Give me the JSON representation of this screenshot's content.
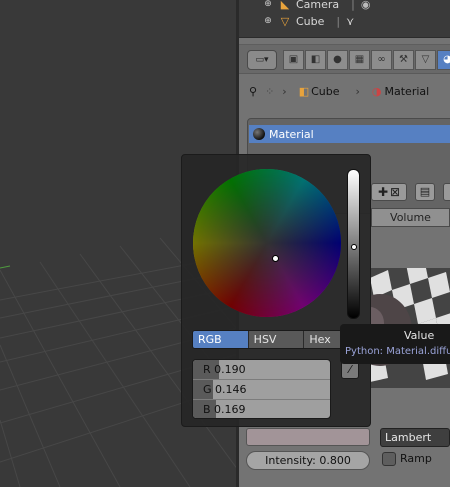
{
  "outliner": {
    "items": [
      {
        "label": "Camera",
        "icon": "camera-icon"
      },
      {
        "label": "Cube",
        "icon": "mesh-icon"
      }
    ]
  },
  "properties": {
    "breadcrumb": [
      "Cube",
      "Material"
    ],
    "material_slot": "Material",
    "preview_tabs": [
      "Volume"
    ],
    "diffuse_shader": "Lambert",
    "intensity_label": "Intensity: 0.800",
    "ramp_label": "Ramp",
    "accent_color": "#5680c2"
  },
  "color_picker": {
    "tabs": [
      "RGB",
      "HSV",
      "Hex"
    ],
    "active_tab": "RGB",
    "value_fraction": 0.5,
    "channels": [
      {
        "label": "R 0.190",
        "value": 0.19
      },
      {
        "label": "G 0.146",
        "value": 0.146
      },
      {
        "label": "B 0.169",
        "value": 0.169
      }
    ]
  },
  "tooltip": {
    "title": "Value",
    "python": "Python: Material.diffu"
  }
}
